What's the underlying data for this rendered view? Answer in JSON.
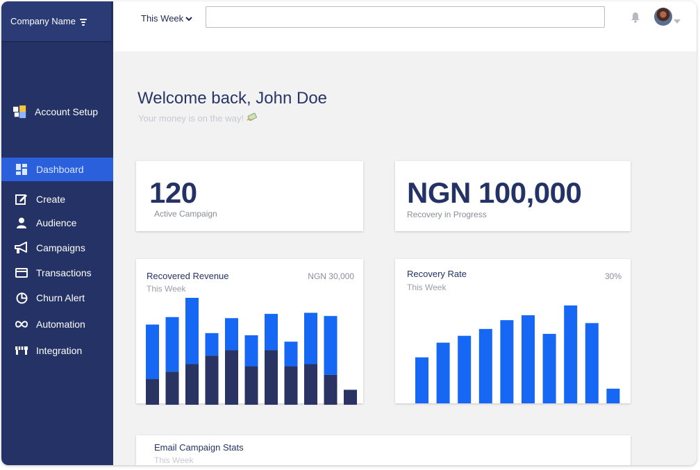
{
  "sidebar": {
    "company_name": "Company Name",
    "account_setup": "Account Setup",
    "items": [
      {
        "label": "Dashboard",
        "icon": "dashboard-icon",
        "active": true
      },
      {
        "label": "Create",
        "icon": "edit-icon"
      },
      {
        "label": "Audience",
        "icon": "person-icon"
      },
      {
        "label": "Campaigns",
        "icon": "megaphone-icon"
      },
      {
        "label": "Transactions",
        "icon": "card-icon"
      },
      {
        "label": "Churn Alert",
        "icon": "pie-chart-icon"
      },
      {
        "label": "Automation",
        "icon": "infinity-icon"
      },
      {
        "label": "Integration",
        "icon": "store-icon"
      }
    ]
  },
  "topbar": {
    "period": "This Week",
    "search_value": ""
  },
  "welcome": {
    "title": "Welcome back, John Doe",
    "subtitle": "Your money is on the way!"
  },
  "stats": {
    "active_campaign": {
      "value": "120",
      "label": "Active Campaign"
    },
    "recovery": {
      "value": "NGN 100,000",
      "label": "Recovery in Progress"
    }
  },
  "recovered_revenue": {
    "title": "Recovered Revenue",
    "period": "This Week",
    "value": "NGN 30,000"
  },
  "recovery_rate": {
    "title": "Recovery Rate",
    "period": "This Week",
    "value": "30%"
  },
  "email_stats": {
    "title": "Email Campaign Stats",
    "period": "This Week"
  },
  "colors": {
    "sidebar": "#243266",
    "active": "#2b60dc",
    "bar_blue": "#1767f5",
    "bar_dark": "#293462"
  },
  "chart_data": [
    {
      "type": "bar",
      "title": "Recovered Revenue",
      "stacked": true,
      "categories": [
        "1",
        "2",
        "3",
        "4",
        "5",
        "6",
        "7",
        "8",
        "9",
        "10",
        "11"
      ],
      "ylim": [
        0,
        100
      ],
      "series": [
        {
          "values": [
            24,
            31,
            38,
            46,
            51,
            36,
            51,
            36,
            38,
            28,
            14
          ]
        },
        {
          "values": [
            51,
            51,
            62,
            21,
            30,
            29,
            34,
            23,
            48,
            55,
            0
          ]
        }
      ]
    },
    {
      "type": "bar",
      "title": "Recovery Rate",
      "categories": [
        "1",
        "2",
        "3",
        "4",
        "5",
        "6",
        "7",
        "8",
        "9",
        "10"
      ],
      "ylim": [
        0,
        100
      ],
      "series": [
        {
          "values": [
            47,
            62,
            69,
            76,
            85,
            90,
            71,
            100,
            82,
            15
          ]
        }
      ]
    }
  ]
}
